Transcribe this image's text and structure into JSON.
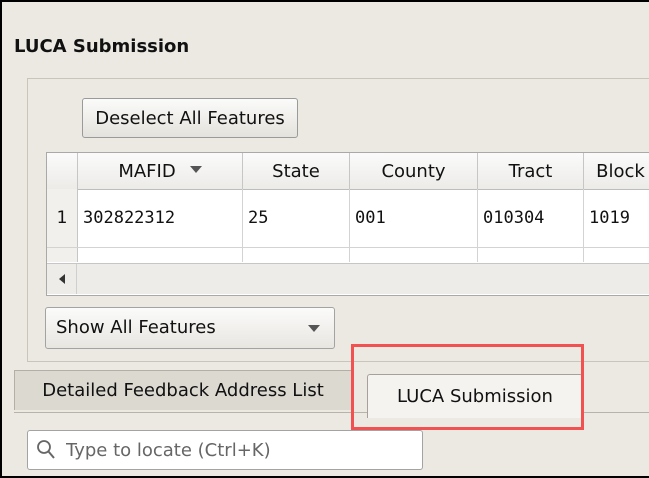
{
  "panel": {
    "title": "LUCA Submission",
    "deselect_button": "Deselect All Features",
    "filter_combo": "Show All Features"
  },
  "table": {
    "columns": [
      {
        "label": "MAFID",
        "sorted": "descending"
      },
      {
        "label": "State"
      },
      {
        "label": "County"
      },
      {
        "label": "Tract"
      },
      {
        "label": "Block"
      }
    ],
    "rows": [
      {
        "index": "1",
        "cells": [
          "302822312",
          "25",
          "001",
          "010304",
          "1019"
        ]
      }
    ]
  },
  "tabs": [
    {
      "label": "Detailed Feedback Address List",
      "active": false
    },
    {
      "label": "LUCA Submission",
      "active": true
    }
  ],
  "search": {
    "placeholder": "Type to locate (Ctrl+K)",
    "icon": "search-icon"
  },
  "colors": {
    "highlight": "#f15151",
    "panel_bg": "#ece9e2"
  }
}
